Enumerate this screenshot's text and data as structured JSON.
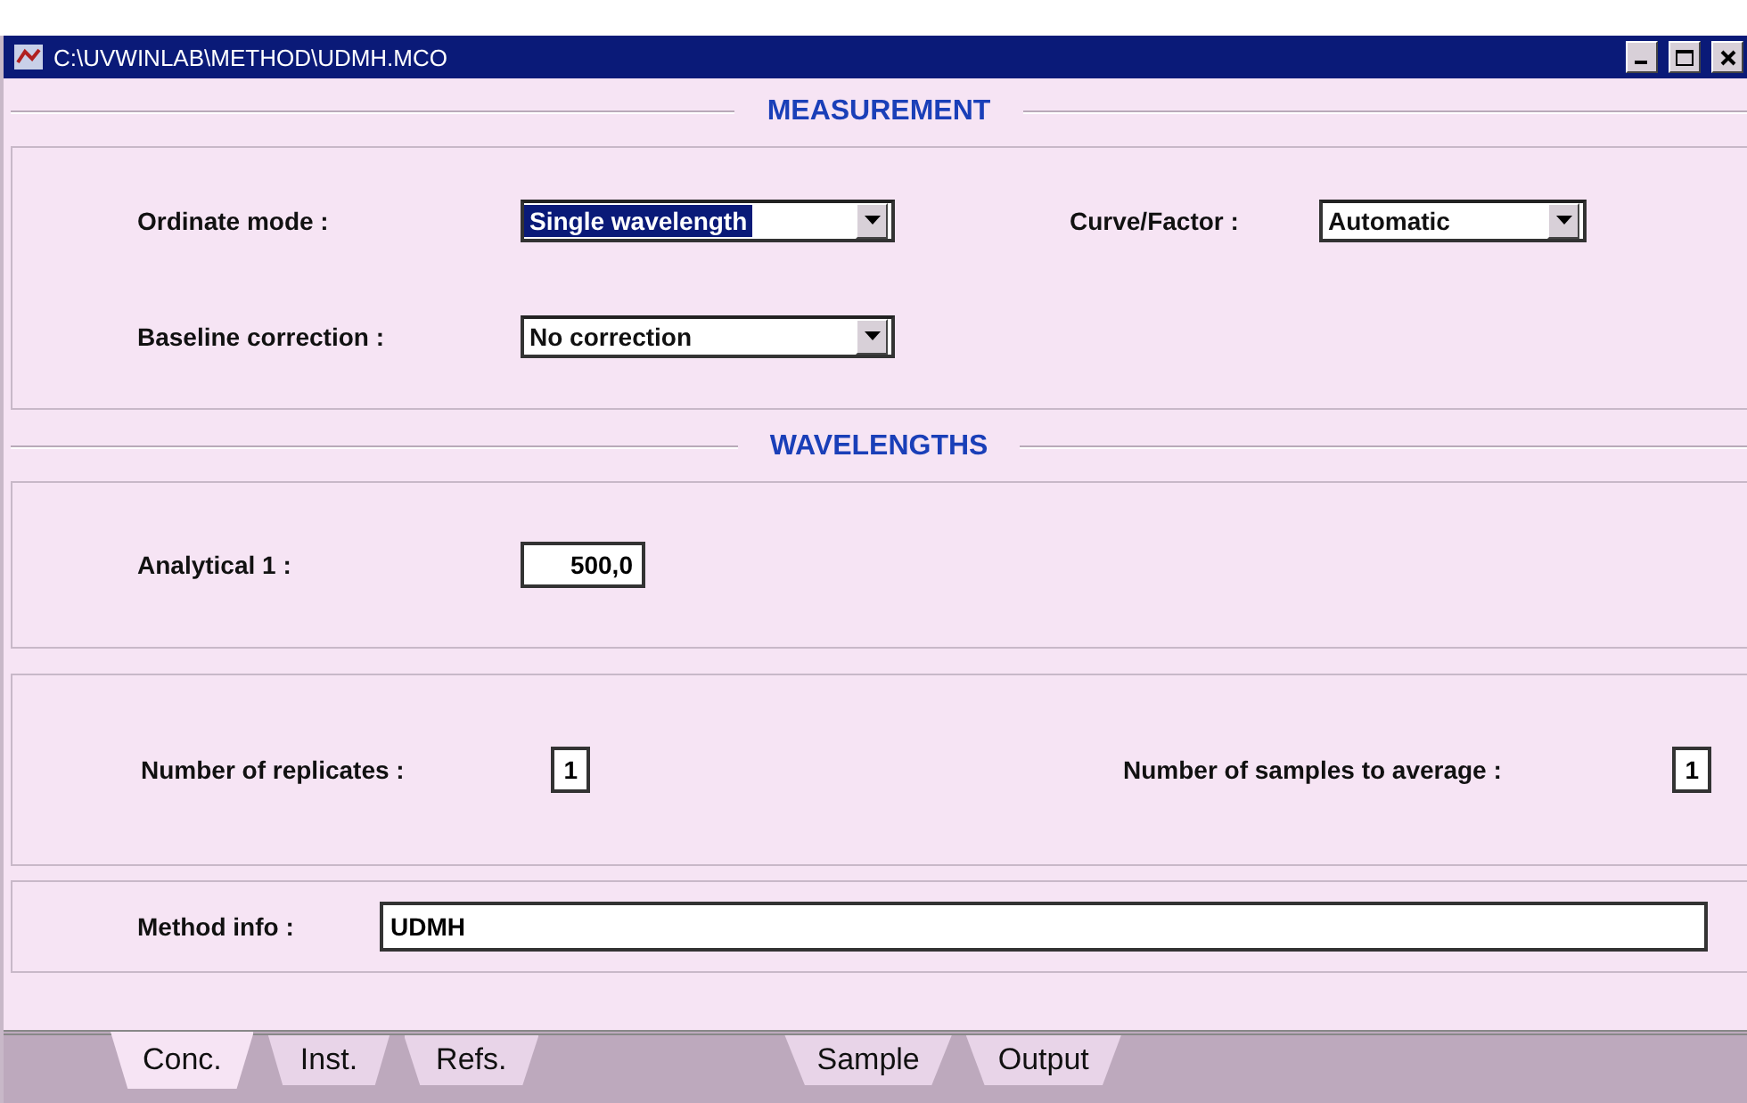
{
  "window": {
    "title": "C:\\UVWINLAB\\METHOD\\UDMH.MCO"
  },
  "sections": [
    {
      "title": "MEASUREMENT",
      "rows": [
        {
          "fields": [
            {
              "label": "Ordinate mode :",
              "kind": "dropdown",
              "value": "Single wavelength",
              "focused": true
            },
            {
              "label": "Curve/Factor :",
              "kind": "dropdown",
              "value": "Automatic",
              "focused": false
            }
          ]
        },
        {
          "fields": [
            {
              "label": "Baseline correction :",
              "kind": "dropdown",
              "value": "No correction",
              "focused": false
            }
          ]
        }
      ]
    },
    {
      "title": "WAVELENGTHS",
      "rows": [
        {
          "fields": [
            {
              "label": "Analytical 1 :",
              "kind": "number",
              "value": "500,0"
            }
          ]
        }
      ]
    }
  ],
  "replicates": [
    {
      "label": "Number of replicates :",
      "value": "1"
    },
    {
      "label": "Number of samples to average :",
      "value": "1"
    }
  ],
  "method_info": {
    "label": "Method info :",
    "value": "UDMH"
  },
  "tabs": [
    {
      "label": "Conc.",
      "selected": true
    },
    {
      "label": "Inst.",
      "selected": false
    },
    {
      "label": "Refs.",
      "selected": false
    },
    {
      "label": "Sample",
      "selected": false
    },
    {
      "label": "Output",
      "selected": false
    }
  ]
}
